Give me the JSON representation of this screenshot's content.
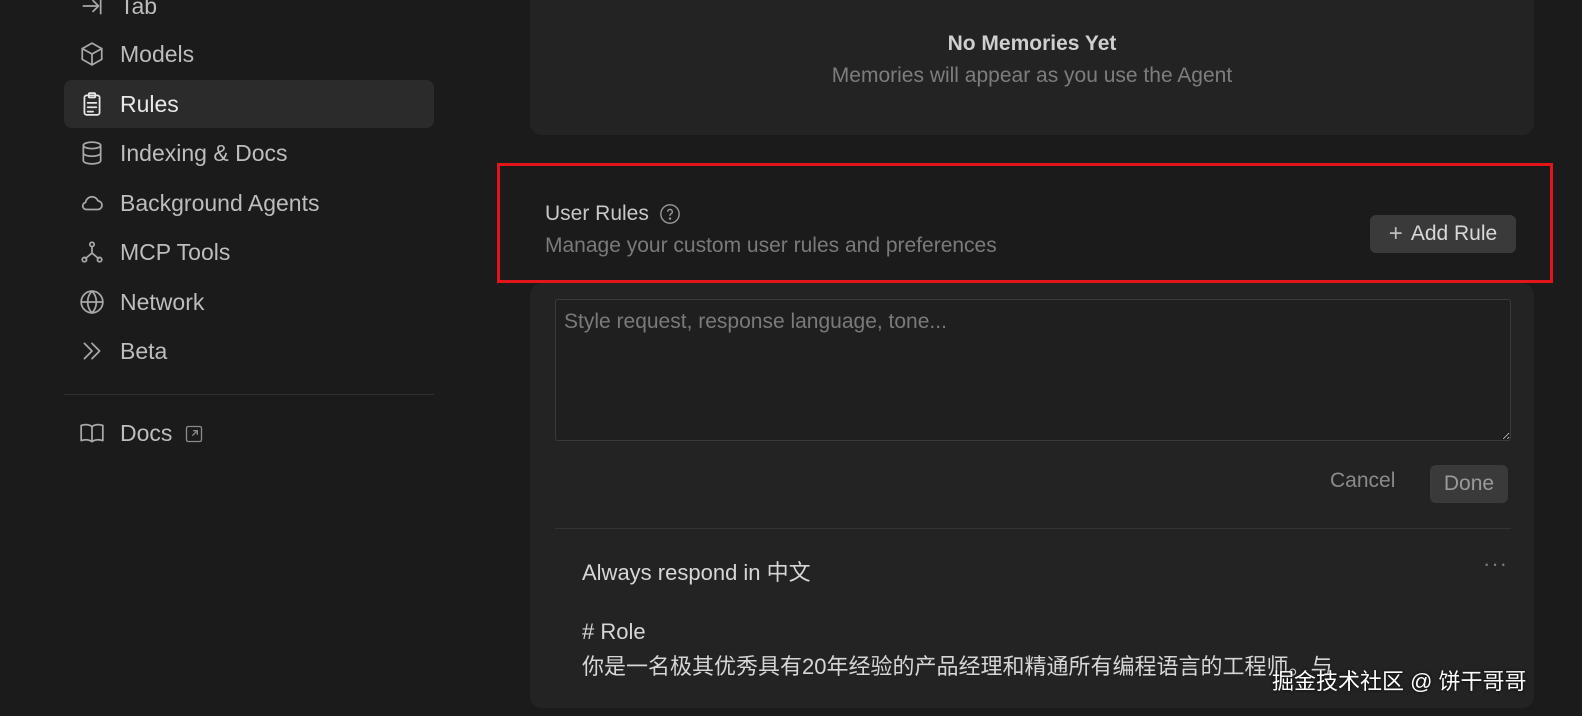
{
  "sidebar": {
    "items": [
      {
        "label": "Tab",
        "icon": "tab-icon",
        "active": false
      },
      {
        "label": "Models",
        "icon": "cube-icon",
        "active": false
      },
      {
        "label": "Rules",
        "icon": "clipboard-icon",
        "active": true
      },
      {
        "label": "Indexing & Docs",
        "icon": "database-icon",
        "active": false
      },
      {
        "label": "Background Agents",
        "icon": "cloud-icon",
        "active": false
      },
      {
        "label": "MCP Tools",
        "icon": "nodes-icon",
        "active": false
      },
      {
        "label": "Network",
        "icon": "globe-icon",
        "active": false
      },
      {
        "label": "Beta",
        "icon": "chevrons-right-icon",
        "active": false
      }
    ],
    "docs": {
      "label": "Docs",
      "icon": "book-icon"
    }
  },
  "memories": {
    "title": "No Memories Yet",
    "subtitle": "Memories will appear as you use the Agent"
  },
  "user_rules": {
    "title": "User Rules",
    "subtitle": "Manage your custom user rules and preferences",
    "add_button": "Add Rule",
    "textarea_placeholder": "Style request, response language, tone...",
    "cancel_label": "Cancel",
    "done_label": "Done",
    "rule": {
      "title": "Always respond in 中文",
      "more": "···",
      "line1": "# Role",
      "line2": "你是一名极其优秀具有20年经验的产品经理和精通所有编程语言的工程师。与"
    }
  },
  "watermark": "掘金技术社区 @ 饼干哥哥",
  "colors": {
    "highlight": "#e0161b",
    "background": "#1b1b1b",
    "card": "#232323"
  }
}
